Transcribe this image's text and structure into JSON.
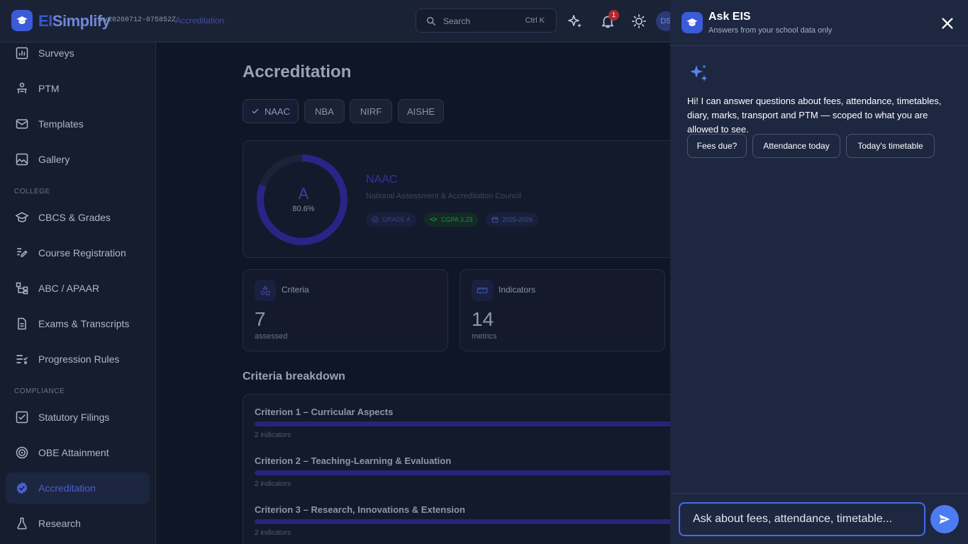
{
  "app": {
    "brand_prefix": "EI",
    "brand_suffix": "Simplify",
    "version": "vv20260712-075852Z",
    "breadcrumb": "Accreditation"
  },
  "topbar": {
    "search_placeholder": "Search",
    "search_shortcut": "Ctrl K",
    "notification_count": "1",
    "avatar_initials": "DS"
  },
  "sidebar": {
    "items_top": [
      "Surveys",
      "PTM",
      "Templates",
      "Gallery"
    ],
    "section_college": "COLLEGE",
    "items_college": [
      "CBCS & Grades",
      "Course Registration",
      "ABC / APAAR",
      "Exams & Transcripts",
      "Progression Rules"
    ],
    "section_compliance": "COMPLIANCE",
    "items_compliance": [
      "Statutory Filings",
      "OBE Attainment",
      "Accreditation",
      "Research"
    ]
  },
  "main": {
    "title": "Accreditation",
    "frameworks": [
      "NAAC",
      "NBA",
      "NIRF",
      "AISHE"
    ],
    "selected_framework": "NAAC",
    "score": {
      "grade": "A",
      "percent": "80.6%",
      "percent_value": 80.6,
      "name": "NAAC",
      "full_name": "National Assessment & Accreditation Council",
      "pill_grade": "GRADE A",
      "pill_cgpa": "CGPA 3.23",
      "pill_year": "2025-2026"
    },
    "stats": [
      {
        "label": "Criteria",
        "value": "7",
        "sub": "assessed"
      },
      {
        "label": "Indicators",
        "value": "14",
        "sub": "metrics"
      }
    ],
    "breakdown_title": "Criteria breakdown",
    "criteria": [
      {
        "title": "Criterion 1 – Curricular Aspects",
        "sub": "2 indicators"
      },
      {
        "title": "Criterion 2 – Teaching-Learning & Evaluation",
        "sub": "2 indicators"
      },
      {
        "title": "Criterion 3 – Research, Innovations & Extension",
        "sub": "2 indicators"
      }
    ]
  },
  "chat": {
    "title": "Ask EIS",
    "subtitle": "Answers from your school data only",
    "intro": "Hi! I can answer questions about fees, attendance, timetables, diary, marks, transport and PTM — scoped to what you are allowed to see.",
    "suggestions": [
      "Fees due?",
      "Attendance today",
      "Today's timetable"
    ],
    "input_placeholder": "Ask about fees, attendance, timetable...",
    "input_value": ""
  },
  "colors": {
    "accent": "#3f6bf0",
    "send_button": "#4d7cf2",
    "panel_bg": "#1e2740",
    "active_nav": "#4960cf"
  }
}
